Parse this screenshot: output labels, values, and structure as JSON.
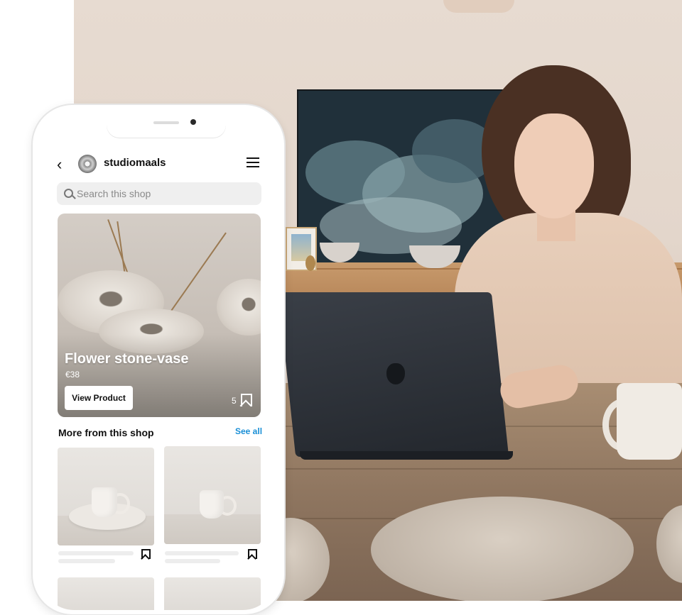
{
  "shop": {
    "username": "studiomaals",
    "search_placeholder": "Search this shop"
  },
  "featured_product": {
    "title": "Flower stone-vase",
    "price": "€38",
    "view_button_label": "View Product",
    "save_count": "5"
  },
  "more_section": {
    "title": "More from this shop",
    "see_all_label": "See all"
  },
  "icons": {
    "back": "chevron-left-icon",
    "menu": "hamburger-menu-icon",
    "search": "search-icon",
    "bookmark": "bookmark-icon"
  },
  "colors": {
    "link_blue": "#1a8fd6",
    "text_primary": "#111111",
    "search_bg": "#efefef"
  }
}
